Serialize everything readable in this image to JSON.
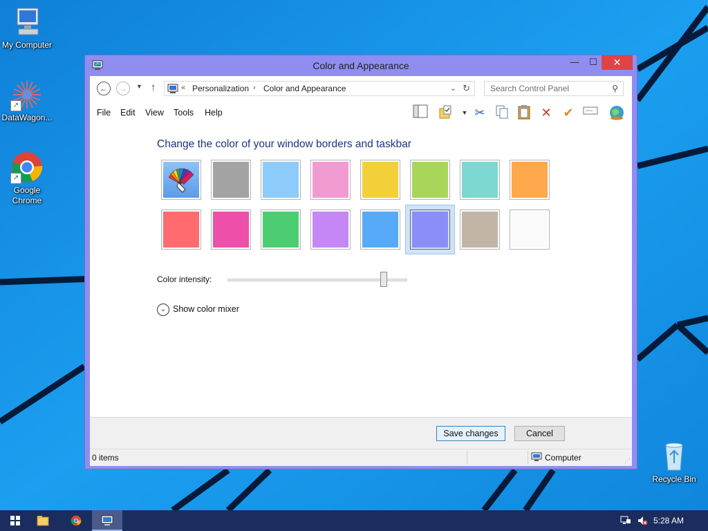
{
  "desktop": {
    "icons": [
      {
        "label": "My Computer",
        "icon": "computer-icon"
      },
      {
        "label": "DataWagon...",
        "icon": "datawagon-icon"
      },
      {
        "label": "Google Chrome",
        "icon": "chrome-icon"
      },
      {
        "label": "Recycle Bin",
        "icon": "recycle-bin-icon"
      }
    ]
  },
  "window": {
    "title": "Color and Appearance",
    "controls": {
      "minimize": "—",
      "maximize": "☐",
      "close": "✕"
    },
    "address": {
      "prefix": "«",
      "crumbs": [
        "Personalization",
        "Color and Appearance"
      ]
    },
    "search_placeholder": "Search Control Panel",
    "menu": [
      "File",
      "Edit",
      "View",
      "Tools",
      "Help"
    ],
    "heading": "Change the color of your window borders and taskbar",
    "swatches": [
      {
        "name": "automatic",
        "color": "#6aa9f0"
      },
      {
        "name": "gray",
        "color": "#a3a3a3"
      },
      {
        "name": "light-blue",
        "color": "#8ccbfb"
      },
      {
        "name": "pink",
        "color": "#f29bd2"
      },
      {
        "name": "yellow",
        "color": "#f3cf3a"
      },
      {
        "name": "lime",
        "color": "#a8d65a"
      },
      {
        "name": "teal",
        "color": "#7bd8d2"
      },
      {
        "name": "orange",
        "color": "#ffa84c"
      },
      {
        "name": "red",
        "color": "#ff6b6e"
      },
      {
        "name": "magenta",
        "color": "#ee4fa8"
      },
      {
        "name": "green",
        "color": "#4ccd72"
      },
      {
        "name": "purple",
        "color": "#c587f5"
      },
      {
        "name": "blue",
        "color": "#56aaf8"
      },
      {
        "name": "periwinkle",
        "color": "#8b8ef8",
        "selected": true
      },
      {
        "name": "taupe",
        "color": "#c2b4a6"
      },
      {
        "name": "white",
        "color": "#fafafa"
      }
    ],
    "intensity_label": "Color intensity:",
    "intensity_value": 0.87,
    "mixer_label": "Show color mixer",
    "save_label": "Save changes",
    "cancel_label": "Cancel",
    "status_items": "0 items",
    "status_location": "Computer",
    "accent_color": "#8f8df0"
  },
  "taskbar": {
    "clock": "5:28 AM"
  }
}
